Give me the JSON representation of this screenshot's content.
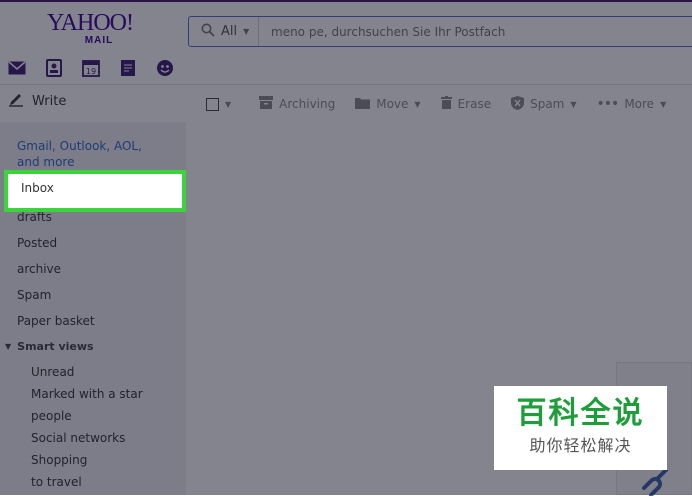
{
  "app": {
    "logo_line1": "YAHOO!",
    "logo_line2": "MAIL"
  },
  "search": {
    "scope": "All",
    "placeholder": "meno pe, durchsuchen Sie Ihr Postfach"
  },
  "app_icons": [
    "mail-icon",
    "contacts-icon",
    "calendar-icon",
    "notepad-icon",
    "messenger-icon"
  ],
  "calendar_day": "19",
  "compose": {
    "label": "Write"
  },
  "promo": "Gmail, Outlook, AOL, and more",
  "folders": [
    "Inbox",
    "drafts",
    "Posted",
    "archive",
    "Spam",
    "Paper basket"
  ],
  "smart_views": {
    "header": "Smart views",
    "items": [
      "Unread",
      "Marked with a star",
      "people",
      "Social networks",
      "Shopping",
      "to travel"
    ]
  },
  "toolbar": {
    "archive": "Archiving",
    "move": "Move",
    "erase": "Erase",
    "spam": "Spam",
    "more": "More"
  },
  "watermark": {
    "line1": "百科全说",
    "line2": "助你轻松解决"
  },
  "colors": {
    "yahoo_purple": "#400090",
    "highlight": "#3bd43b",
    "link_blue": "#2b6ac9",
    "watermark_green": "#1e9e3a"
  }
}
